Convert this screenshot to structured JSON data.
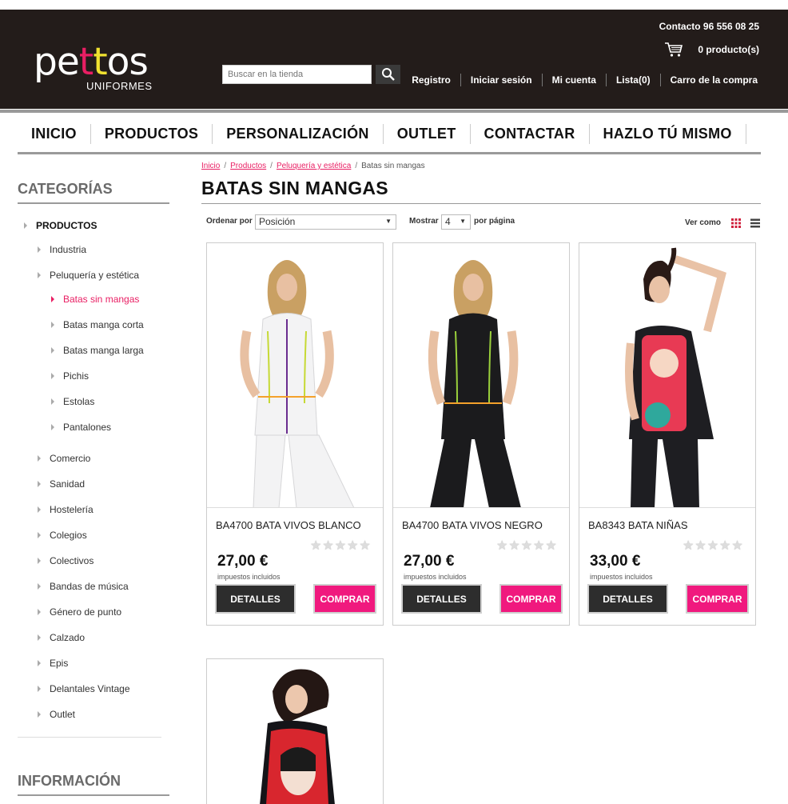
{
  "header": {
    "logo_main_pre": "pe",
    "logo_t1": "t",
    "logo_t2": "t",
    "logo_main_post": "os",
    "logo_sub": "UNIFORMES",
    "contact": "Contacto 96 556 08 25",
    "cart_count": "0 producto(s)",
    "search_placeholder": "Buscar en la tienda",
    "links": [
      "Registro",
      "Iniciar sesión",
      "Mi cuenta",
      "Lista(0)",
      "Carro de la compra"
    ]
  },
  "nav": [
    "INICIO",
    "PRODUCTOS",
    "PERSONALIZACIÓN",
    "OUTLET",
    "CONTACTAR",
    "HAZLO TÚ MISMO"
  ],
  "sidebar": {
    "title": "CATEGORÍAS",
    "root": "PRODUCTOS",
    "categories": [
      "Industria",
      "Peluquería y estética",
      "Batas sin mangas",
      "Batas manga corta",
      "Batas manga larga",
      "Pichis",
      "Estolas",
      "Pantalones",
      "Comercio",
      "Sanidad",
      "Hostelería",
      "Colegios",
      "Colectivos",
      "Bandas de música",
      "Género de punto",
      "Calzado",
      "Epis",
      "Delantales Vintage",
      "Outlet"
    ],
    "info_title": "INFORMACIÓN"
  },
  "breadcrumb": [
    "Inicio",
    "Productos",
    "Peluquería y estética",
    "Batas sin mangas"
  ],
  "page_title": "BATAS SIN MANGAS",
  "toolbar": {
    "sort_label": "Ordenar por",
    "sort_value": "Posición",
    "show_label": "Mostrar",
    "show_value": "4",
    "per_page": "por página",
    "view_label": "Ver como"
  },
  "products": [
    {
      "name": "BA4700 BATA VIVOS BLANCO",
      "price": "27,00 €",
      "tax": "impuestos incluidos",
      "details": "DETALLES",
      "buy": "COMPRAR",
      "rating": 0
    },
    {
      "name": "BA4700 BATA VIVOS NEGRO",
      "price": "27,00 €",
      "tax": "impuestos incluidos",
      "details": "DETALLES",
      "buy": "COMPRAR",
      "rating": 0
    },
    {
      "name": "BA8343 BATA NIÑAS",
      "price": "33,00 €",
      "tax": "impuestos incluidos",
      "details": "DETALLES",
      "buy": "COMPRAR",
      "rating": 0
    }
  ],
  "colors": {
    "brand_pink": "#f0197e",
    "header_bg": "#231c1a",
    "button_dark": "#2d2d2d"
  }
}
